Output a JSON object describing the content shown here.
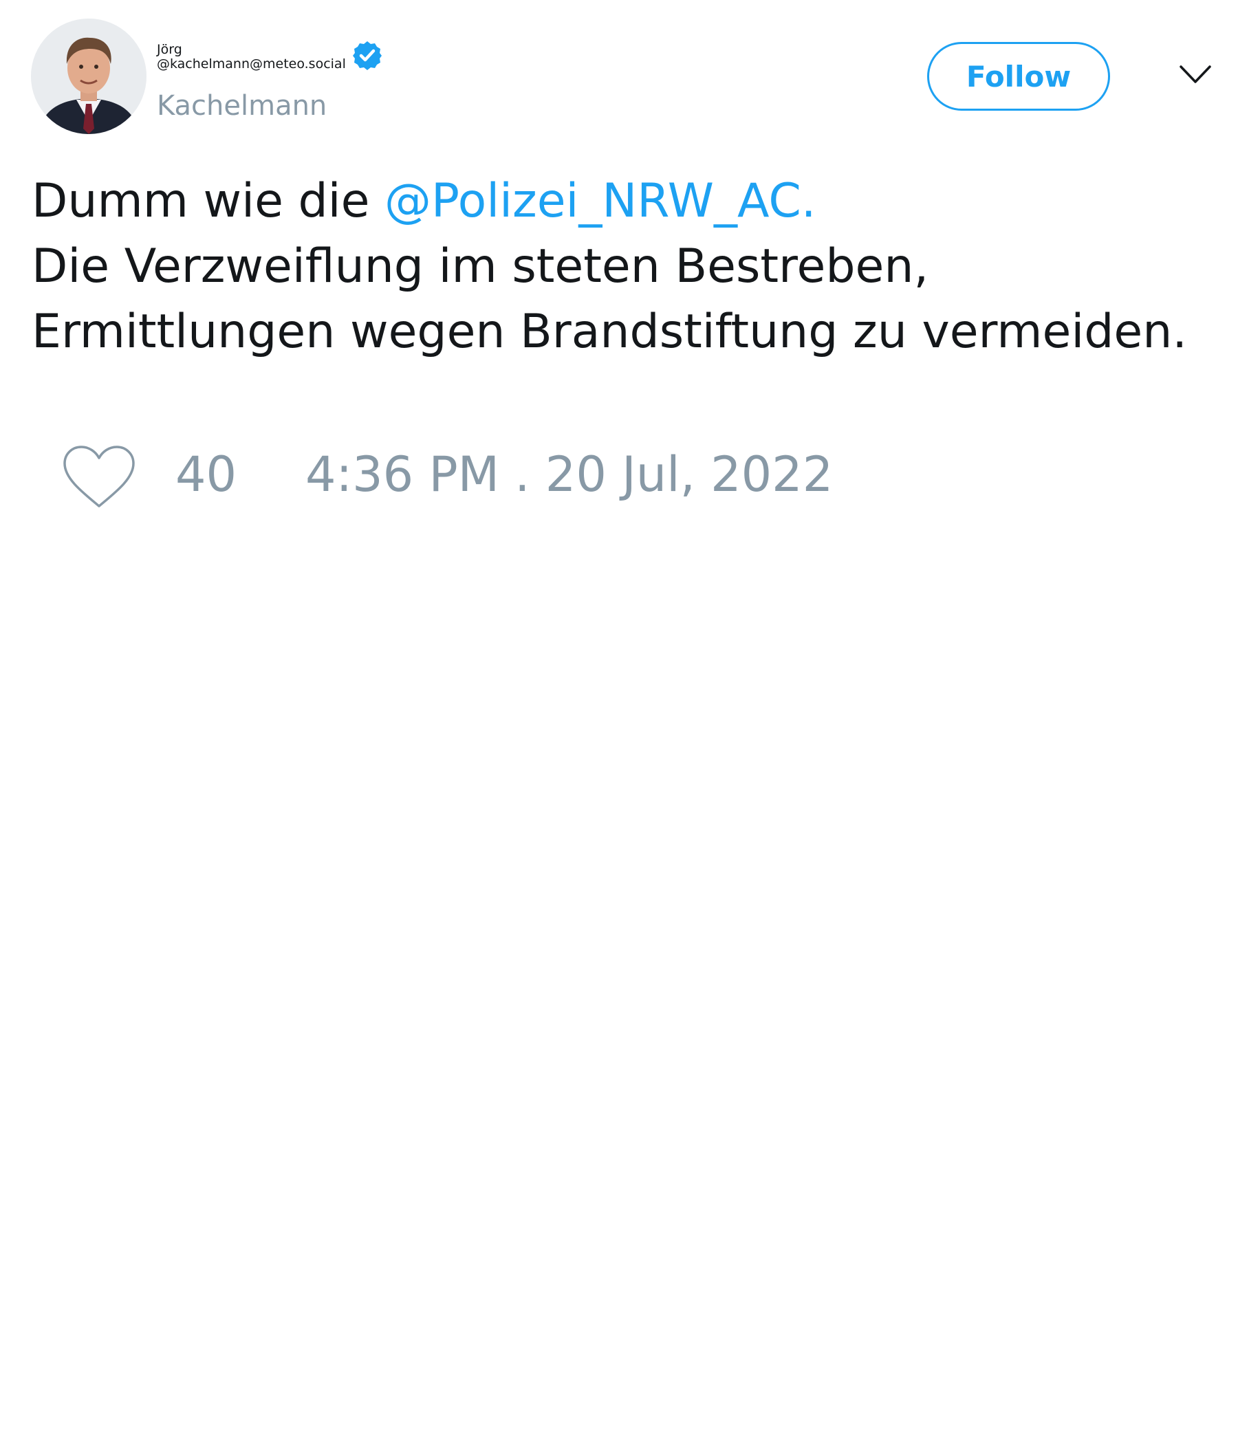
{
  "author": {
    "first_name": "Jörg",
    "handle": "@kachelmann@meteo.social",
    "surname": "Kachelmann",
    "verified": true
  },
  "follow_button": {
    "label": "Follow"
  },
  "tweet": {
    "line1_prefix": "Dumm wie die ",
    "mention": "@Polizei_NRW_AC.",
    "line2": "Die Verzweiflung im steten Bestreben,",
    "line3": "Ermittlungen wegen Brandstiftung zu vermeiden."
  },
  "footer": {
    "like_count": "40",
    "timestamp": "4:36 PM . 20 Jul, 2022"
  },
  "icons": {
    "verified": "verified-badge-icon",
    "chevron": "chevron-down-icon",
    "like": "heart-icon"
  },
  "colors": {
    "accent": "#1da1f2",
    "muted": "#8899a6",
    "text": "#14171a"
  }
}
